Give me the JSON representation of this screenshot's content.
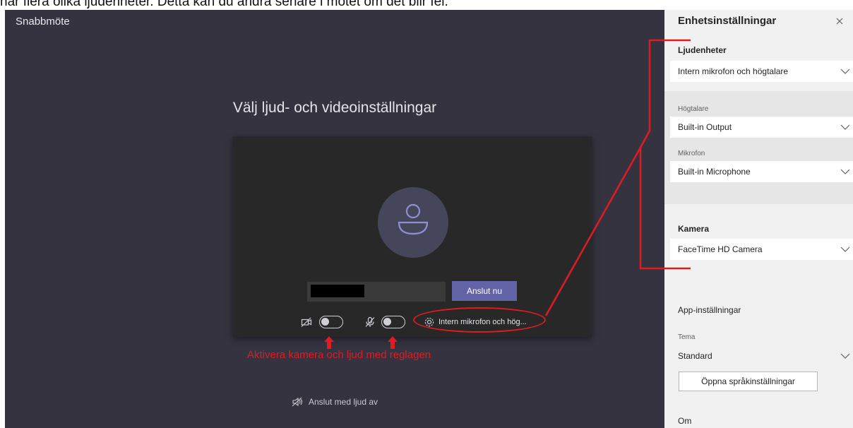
{
  "top_text": "har flera olika ljudenheter. Detta kan du ändra senare i mötet om det blir fel.",
  "meeting": {
    "title": "Snabbmöte",
    "heading": "Välj ljud- och videoinställningar",
    "join_label": "Anslut nu",
    "device_label": "Intern mikrofon och hög...",
    "join_muted_label": "Anslut med ljud av"
  },
  "annotation": {
    "caption": "Aktivera kamera och ljud med reglagen",
    "color": "#e11b22"
  },
  "panel": {
    "title": "Enhetsinställningar",
    "audio": {
      "label": "Ljudenheter",
      "value": "Intern mikrofon och högtalare"
    },
    "speaker": {
      "label": "Högtalare",
      "value": "Built-in Output"
    },
    "microphone": {
      "label": "Mikrofon",
      "value": "Built-in Microphone"
    },
    "camera": {
      "label": "Kamera",
      "value": "FaceTime HD Camera"
    },
    "app_settings": {
      "label": "App-inställningar"
    },
    "theme": {
      "label": "Tema",
      "value": "Standard"
    },
    "language_button": "Öppna språkinställningar",
    "about": "Om"
  },
  "colors": {
    "stage": "#34333f",
    "accent": "#6264a7",
    "panel": "#f1f1f1"
  }
}
